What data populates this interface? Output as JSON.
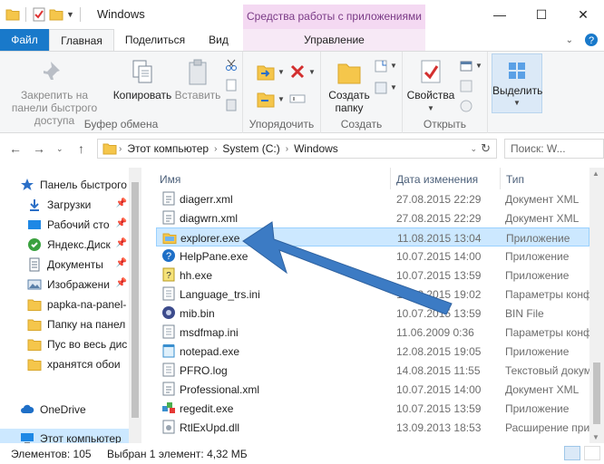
{
  "window": {
    "title": "Windows",
    "context_tab_title": "Средства работы с приложениями",
    "controls": {
      "minimize": "—",
      "maximize": "☐",
      "close": "✕"
    }
  },
  "tabs": [
    {
      "label": "Файл"
    },
    {
      "label": "Главная"
    },
    {
      "label": "Поделиться"
    },
    {
      "label": "Вид"
    },
    {
      "label": "Управление"
    }
  ],
  "ribbon": {
    "clipboard": {
      "label": "Буфер обмена",
      "pin": "Закрепить на панели быстрого доступа",
      "copy": "Копировать",
      "paste": "Вставить"
    },
    "organize": {
      "label": "Упорядочить"
    },
    "create": {
      "label": "Создать",
      "new_folder": "Создать папку"
    },
    "open": {
      "label": "Открыть",
      "properties": "Свойства"
    },
    "select": {
      "label": "Выделить"
    }
  },
  "address": {
    "crumbs": [
      "Этот компьютер",
      "System (C:)",
      "Windows"
    ],
    "search_placeholder": "Поиск: W..."
  },
  "nav": {
    "items": [
      {
        "label": "Панель быстрого",
        "icon": "star-icon",
        "color": "#2b6fc7",
        "pinned": false
      },
      {
        "label": "Загрузки",
        "icon": "download-icon",
        "color": "#2b6fc7",
        "pinned": true
      },
      {
        "label": "Рабочий сто",
        "icon": "desktop-icon",
        "color": "#1e88e5",
        "pinned": true
      },
      {
        "label": "Яндекс.Диск",
        "icon": "yandex-disk-icon",
        "color": "#3aa13f",
        "pinned": true
      },
      {
        "label": "Документы",
        "icon": "documents-icon",
        "color": "#6b7b8c",
        "pinned": true
      },
      {
        "label": "Изображени",
        "icon": "pictures-icon",
        "color": "#5a7fa8",
        "pinned": true
      },
      {
        "label": "papka-na-panel-",
        "icon": "folder-icon",
        "color": "#f5c64b",
        "pinned": false
      },
      {
        "label": "Папку на панел",
        "icon": "folder-icon",
        "color": "#f5c64b",
        "pinned": false
      },
      {
        "label": "Пус во весь дис",
        "icon": "folder-icon",
        "color": "#f5c64b",
        "pinned": false
      },
      {
        "label": "хранятся обои",
        "icon": "folder-icon",
        "color": "#f5c64b",
        "pinned": false
      },
      {
        "label": "OneDrive",
        "icon": "cloud-icon",
        "color": "#1e6fc7",
        "pinned": false
      },
      {
        "label": "Этот компьютер",
        "icon": "computer-icon",
        "color": "#1e88e5",
        "pinned": false
      }
    ]
  },
  "columns": {
    "name": "Имя",
    "date": "Дата изменения",
    "type": "Тип"
  },
  "files": [
    {
      "name": "diagerr.xml",
      "date": "27.08.2015 22:29",
      "type": "Документ XML",
      "icon": "xml-file-icon"
    },
    {
      "name": "diagwrn.xml",
      "date": "27.08.2015 22:29",
      "type": "Документ XML",
      "icon": "xml-file-icon"
    },
    {
      "name": "explorer.exe",
      "date": "11.08.2015 13:04",
      "type": "Приложение",
      "icon": "explorer-icon"
    },
    {
      "name": "HelpPane.exe",
      "date": "10.07.2015 14:00",
      "type": "Приложение",
      "icon": "help-icon"
    },
    {
      "name": "hh.exe",
      "date": "10.07.2015 13:59",
      "type": "Приложение",
      "icon": "hh-icon"
    },
    {
      "name": "Language_trs.ini",
      "date": "10.03.2015 19:02",
      "type": "Параметры конф",
      "icon": "ini-file-icon"
    },
    {
      "name": "mib.bin",
      "date": "10.07.2015 13:59",
      "type": "BIN File",
      "icon": "bin-file-icon"
    },
    {
      "name": "msdfmap.ini",
      "date": "11.06.2009 0:36",
      "type": "Параметры конф",
      "icon": "ini-file-icon"
    },
    {
      "name": "notepad.exe",
      "date": "12.08.2015 19:05",
      "type": "Приложение",
      "icon": "notepad-icon"
    },
    {
      "name": "PFRO.log",
      "date": "14.08.2015 11:55",
      "type": "Текстовый докум",
      "icon": "log-file-icon"
    },
    {
      "name": "Professional.xml",
      "date": "10.07.2015 14:00",
      "type": "Документ XML",
      "icon": "xml-file-icon"
    },
    {
      "name": "regedit.exe",
      "date": "10.07.2015 13:59",
      "type": "Приложение",
      "icon": "regedit-icon"
    },
    {
      "name": "RtlExUpd.dll",
      "date": "13.09.2013 18:53",
      "type": "Расширение при",
      "icon": "dll-file-icon"
    }
  ],
  "status": {
    "count": "Элементов: 105",
    "selection": "Выбран 1 элемент: 4,32 МБ"
  },
  "colors": {
    "accent": "#1979ca",
    "selection": "#cce8ff",
    "arrow": "#3c7bc4"
  }
}
